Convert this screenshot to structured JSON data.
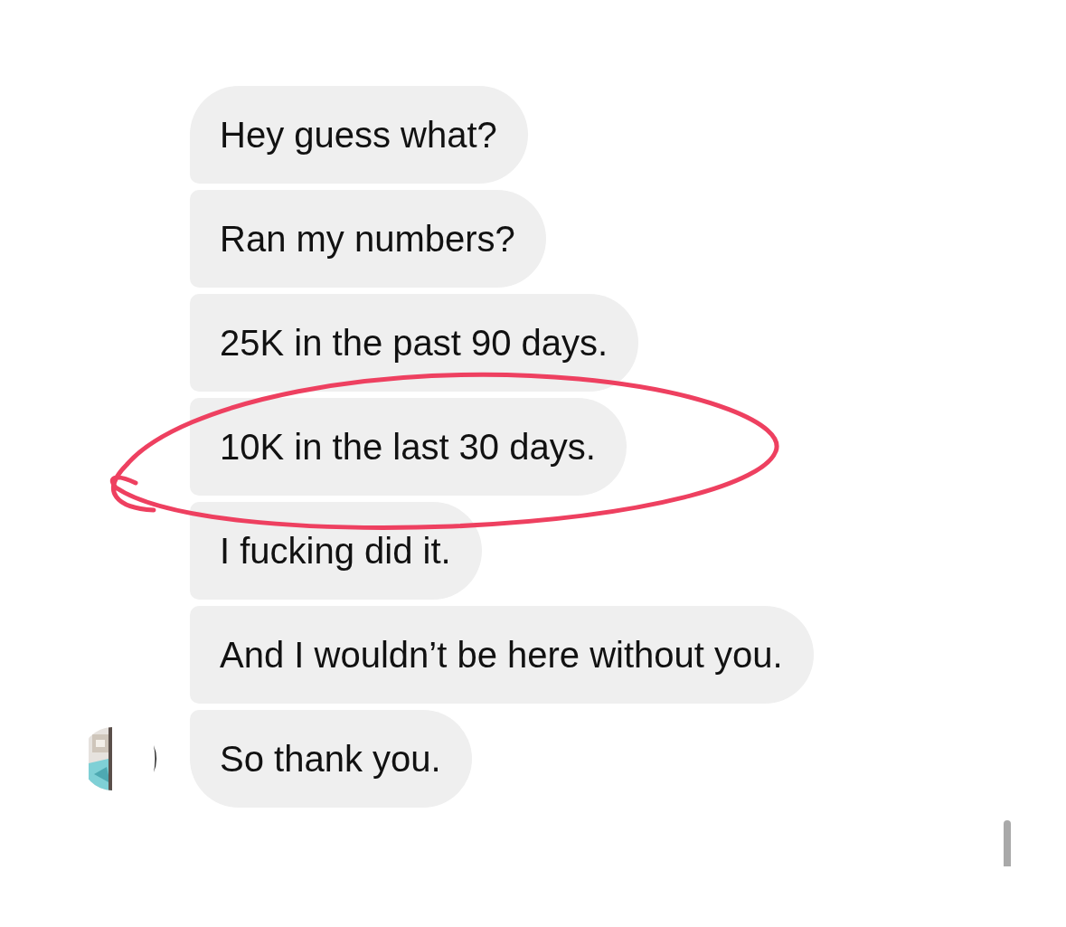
{
  "messages": [
    {
      "text": "Hey guess what?"
    },
    {
      "text": "Ran my numbers?"
    },
    {
      "text": "25K in the past 90 days."
    },
    {
      "text": "10K in the last 30 days.",
      "circled": true
    },
    {
      "text": "I fucking did it."
    },
    {
      "text": "And I wouldn’t be here without you."
    },
    {
      "text": "So thank you."
    }
  ]
}
